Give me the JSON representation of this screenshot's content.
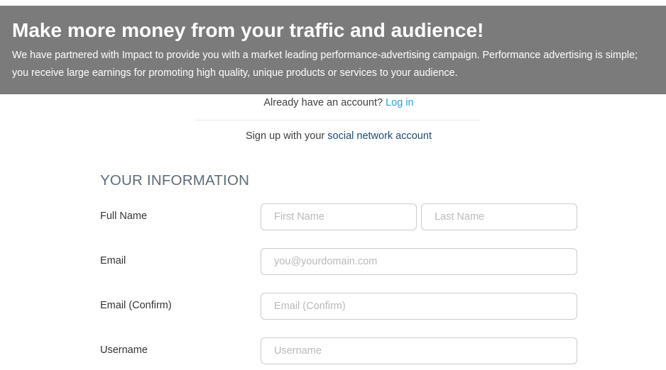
{
  "banner": {
    "title": "Make more money from your traffic and audience!",
    "description": "We have partnered with Impact to provide you with a market leading performance-advertising campaign. Performance advertising is simple; you receive large earnings for promoting high quality, unique products or services to your audience."
  },
  "account": {
    "prompt": "Already have an account? ",
    "login_link": "Log in"
  },
  "social": {
    "prompt": "Sign up with your ",
    "link": "social network account"
  },
  "form": {
    "section_title": "YOUR INFORMATION",
    "full_name": {
      "label": "Full Name",
      "first_placeholder": "First Name",
      "last_placeholder": "Last Name"
    },
    "email": {
      "label": "Email",
      "placeholder": "you@yourdomain.com"
    },
    "email_confirm": {
      "label": "Email (Confirm)",
      "placeholder": "Email (Confirm)"
    },
    "username": {
      "label": "Username",
      "placeholder": "Username"
    }
  },
  "colors": {
    "banner_bg": "#7b7b7b",
    "link": "#2a9fd6",
    "social_link": "#1e4b73",
    "section_title": "#5d6b78"
  }
}
